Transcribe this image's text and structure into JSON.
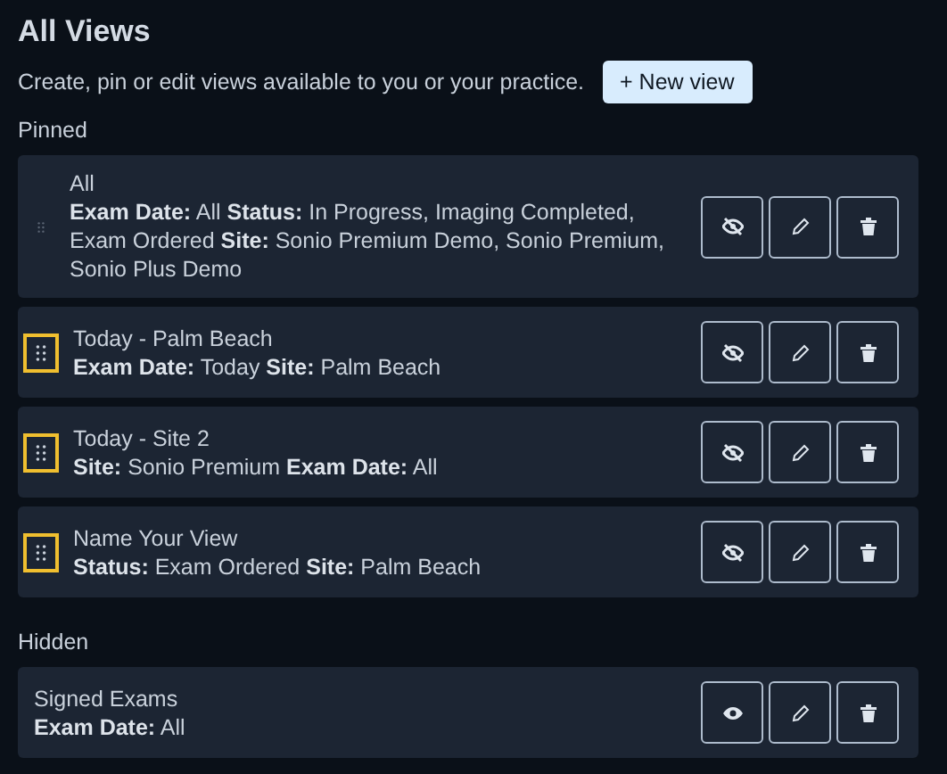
{
  "title": "All Views",
  "subtitle": "Create, pin or edit views available to you or your practice.",
  "new_button": "+ New view",
  "sections": [
    {
      "label": "Pinned",
      "views": [
        {
          "name": "All",
          "filters": "**Exam Date:** All **Status:** In Progress, Imaging Completed, Exam Ordered **Site:** Sonio Premium Demo, Sonio Premium, Sonio Plus Demo",
          "draggable": true,
          "highlighted": false,
          "hidden": false
        },
        {
          "name": "Today - Palm Beach",
          "filters": "**Exam Date:** Today **Site:** Palm Beach",
          "draggable": true,
          "highlighted": true,
          "hidden": false
        },
        {
          "name": "Today - Site 2",
          "filters": "**Site:** Sonio Premium **Exam Date:** All",
          "draggable": true,
          "highlighted": true,
          "hidden": false
        },
        {
          "name": "Name Your View",
          "filters": "**Status:** Exam Ordered **Site:** Palm Beach",
          "draggable": true,
          "highlighted": true,
          "hidden": false
        }
      ]
    },
    {
      "label": "Hidden",
      "views": [
        {
          "name": "Signed Exams",
          "filters": "**Exam Date:** All",
          "draggable": false,
          "hidden": true
        }
      ]
    }
  ]
}
